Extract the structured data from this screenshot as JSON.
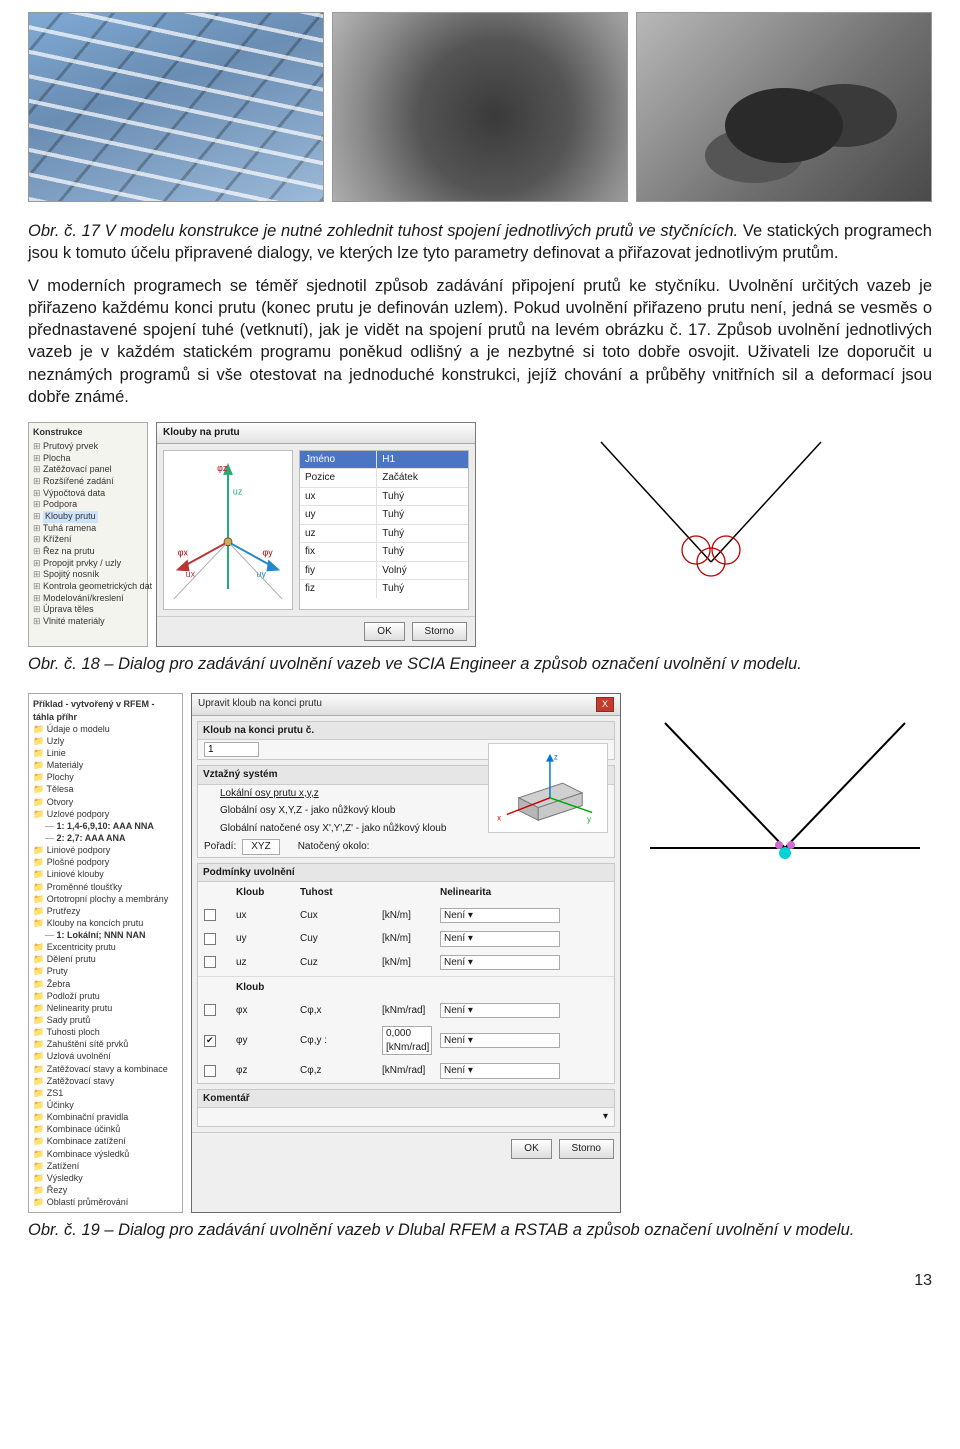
{
  "photos": {
    "alt1": "Steel truss",
    "alt2": "Pin joint",
    "alt3": "Cable clamp"
  },
  "caption17": "Obr. č. 17 V modelu konstrukce je nutné zohlednit tuhost spojení jednotlivých prutů ve styčnících.",
  "para1_tail": " Ve statických programech jsou k tomuto účelu připravené dialogy, ve kterých lze tyto parametry definovat a přiřazovat jednotlivým prutům.",
  "para2": "V moderních programech se téměř sjednotil způsob zadávání připojení prutů ke styčníku. Uvolnění určitých vazeb je přiřazeno každému konci prutu (konec prutu je definován uzlem). Pokud uvolnění přiřazeno prutu není, jedná se vesměs o přednastavené spojení tuhé (vetknutí), jak je vidět na spojení prutů na levém obrázku č. 17. Způsob uvolnění jednotlivých vazeb je v každém statickém programu poněkud odlišný a je nezbytné si toto dobře osvojit. Uživateli lze doporučit u neznámých programů si vše otestovat na jednoduché konstrukci, jejíž chování a průběhy vnitřních sil a deformací jsou dobře známé.",
  "scia": {
    "panel_title": "Konstrukce",
    "tree": [
      "Prutový prvek",
      "Plocha",
      "Zatěžovací panel",
      "Rozšířené zadání",
      "Výpočtová data",
      "Podpora",
      "Klouby prutu",
      "Tuhá ramena",
      "Křížení",
      "Řez na prutu",
      "Propojit prvky / uzly",
      "Spojitý nosník",
      "Kontrola geometrických dat",
      "Modelování/kreslení",
      "Úprava těles",
      "Vlnité materiály"
    ],
    "highlight": "Klouby prutu",
    "dialog_title": "Klouby na prutu",
    "props_header_k": "Jméno",
    "props_header_v": "H1",
    "props": [
      [
        "Pozice",
        "Začátek"
      ],
      [
        "ux",
        "Tuhý"
      ],
      [
        "uy",
        "Tuhý"
      ],
      [
        "uz",
        "Tuhý"
      ],
      [
        "fix",
        "Tuhý"
      ],
      [
        "fiy",
        "Volný"
      ],
      [
        "fiz",
        "Tuhý"
      ]
    ],
    "ax": {
      "ux": "ux",
      "uy": "uy",
      "uz": "uz",
      "fx": "φx",
      "fy": "φy",
      "fz": "φz"
    },
    "ok": "OK",
    "cancel": "Storno"
  },
  "caption18": "Obr. č. 18 – Dialog pro zadávání uvolnění vazeb ve SCIA Engineer a způsob označení uvolnění v modelu.",
  "rfem": {
    "projtitle": "Příklad - vytvořený v RFEM - táhla příhr",
    "tree": [
      "Údaje o modelu",
      "Uzly",
      "Linie",
      "Materiály",
      "Plochy",
      "Tělesa",
      "Otvory",
      "Uzlové podpory"
    ],
    "sub_podpory": [
      "1: 1,4-6,9,10: AAA NNA",
      "2: 2,7: AAA ANA"
    ],
    "tree2": [
      "Liniové podpory",
      "Plošné podpory",
      "Liniové klouby",
      "Proměnné tloušťky",
      "Ortotropní plochy a membrány",
      "Prutřezy",
      "Klouby na koncích prutu"
    ],
    "sub_klouby": "1: Lokální; NNN NAN",
    "tree3": [
      "Excentricity prutu",
      "Dělení prutu",
      "Pruty",
      "Žebra",
      "Podloží prutu",
      "Nelinearity prutu",
      "Sady prutů",
      "Tuhosti ploch",
      "Zahuštění sítě prvků",
      "Uzlová uvolnění",
      "Zatěžovací stavy a kombinace",
      "Zatěžovací stavy",
      "ZS1",
      "Účinky",
      "Kombinační pravidla",
      "Kombinace účinků",
      "Kombinace zatížení",
      "Kombinace výsledků",
      "Zatížení",
      "Výsledky",
      "Řezy",
      "Oblastí průměrování"
    ],
    "dlg_title": "Upravit kloub na konci prutu",
    "sec1": "Kloub na konci prutu č.",
    "sec1_val": "1",
    "sec2": "Vztažný systém",
    "opt1": "Lokální osy prutu x,y,z",
    "opt2": "Globální osy X,Y,Z - jako nůžkový kloub",
    "opt3": "Globální natočené osy X',Y',Z' - jako nůžkový kloub",
    "pos_lbl": "Pořadí:",
    "pos_val": "XYZ",
    "axis_lbl": "Natočený okolo:",
    "sec3": "Podmínky uvolnění",
    "hdr_k": "Kloub",
    "hdr_t": "Tuhost",
    "hdr_n": "Nelinearita",
    "rows1": [
      {
        "chk": false,
        "n": "ux",
        "s": "Cux",
        "v": "",
        "u": "[kN/m]",
        "nl": "Není"
      },
      {
        "chk": false,
        "n": "uy",
        "s": "Cuy",
        "v": "",
        "u": "[kN/m]",
        "nl": "Není"
      },
      {
        "chk": false,
        "n": "uz",
        "s": "Cuz",
        "v": "",
        "u": "[kN/m]",
        "nl": "Není"
      }
    ],
    "hdr_k2": "Kloub",
    "rows2": [
      {
        "chk": false,
        "n": "φx",
        "s": "Cφ,x",
        "v": "",
        "u": "[kNm/rad]",
        "nl": "Není"
      },
      {
        "chk": true,
        "n": "φy",
        "s": "Cφ,y :",
        "v": "0,000",
        "u": "[kNm/rad]",
        "nl": "Není"
      },
      {
        "chk": false,
        "n": "φz",
        "s": "Cφ,z",
        "v": "",
        "u": "[kNm/rad]",
        "nl": "Není"
      }
    ],
    "sec4": "Komentář",
    "ok": "OK",
    "cancel": "Storno"
  },
  "caption19": "Obr. č. 19 – Dialog pro zadávání uvolnění vazeb v Dlubal RFEM a RSTAB a způsob označení uvolnění v modelu.",
  "page": "13"
}
